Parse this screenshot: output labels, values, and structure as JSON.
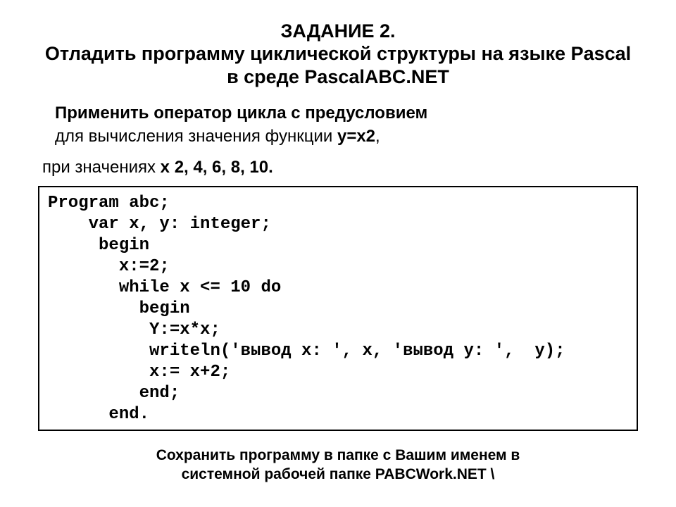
{
  "title_line1": "ЗАДАНИЕ 2.",
  "title_line2": "Отладить программу циклической структуры на языке Pascal в среде PascalABC.NET",
  "instr_l1": "Применить оператор цикла с предусловием",
  "instr_l2a": "для вычисления значения функции ",
  "instr_l2b": "y=x2",
  "instr_l2c": ",",
  "instr_l3a": "при значениях ",
  "instr_l3b": "x   2, 4, 6, 8, 10.",
  "code": {
    "l1": "Program abc;",
    "l2": "    var x, y: integer;",
    "l3": "     begin",
    "l4": "       x:=2;",
    "l5": "       while x <= 10 do",
    "l6": "         begin",
    "l7": "          Y:=x*x;",
    "l8": "          writeln('вывод x: ', x, 'вывод y: ',  y);",
    "l9": "          x:= x+2;",
    "l10": "         end;",
    "l11": "      end."
  },
  "footer_l1": "Сохранить  программу в папке с Вашим именем в",
  "footer_l2": "системной  рабочей папке    PABCWork.NET \\"
}
